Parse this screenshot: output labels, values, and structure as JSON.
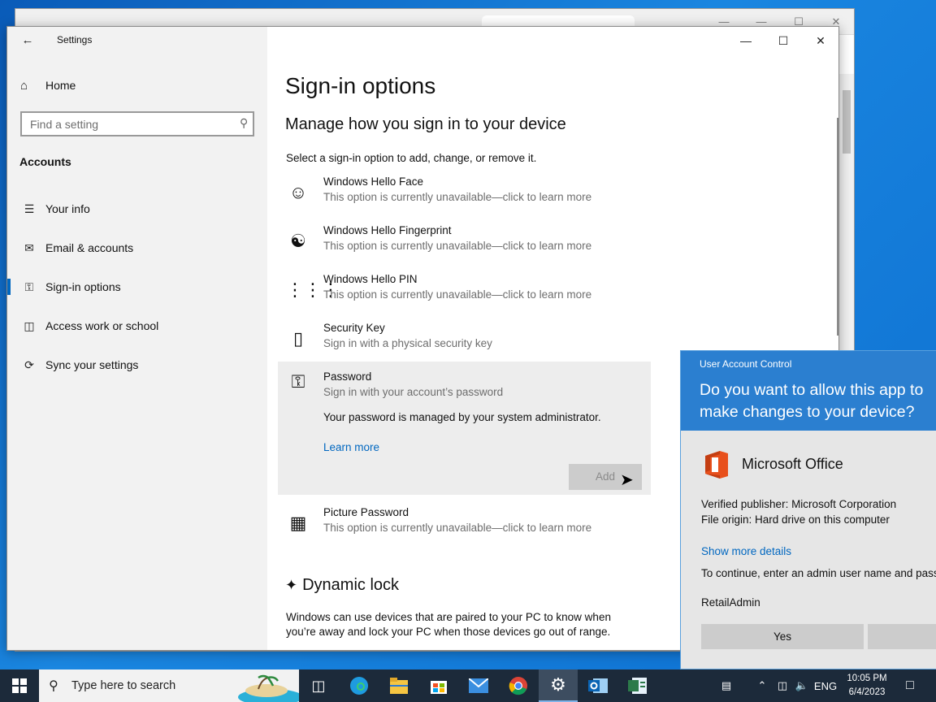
{
  "settings": {
    "app_title": "Settings",
    "home_label": "Home",
    "search_placeholder": "Find a setting",
    "section": "Accounts",
    "nav": [
      {
        "label": "Your info",
        "icon": "person-list-icon"
      },
      {
        "label": "Email & accounts",
        "icon": "mail-icon"
      },
      {
        "label": "Sign-in options",
        "icon": "key-icon",
        "active": true
      },
      {
        "label": "Access work or school",
        "icon": "briefcase-icon"
      },
      {
        "label": "Sync your settings",
        "icon": "sync-icon"
      }
    ],
    "page_title": "Sign-in options",
    "subtitle": "Manage how you sign in to your device",
    "intro": "Select a sign-in option to add, change, or remove it.",
    "options": [
      {
        "title": "Windows Hello Face",
        "desc": "This option is currently unavailable—click to learn more",
        "icon": "face-icon"
      },
      {
        "title": "Windows Hello Fingerprint",
        "desc": "This option is currently unavailable—click to learn more",
        "icon": "fingerprint-icon"
      },
      {
        "title": "Windows Hello PIN",
        "desc": "This option is currently unavailable—click to learn more",
        "icon": "pin-keypad-icon"
      },
      {
        "title": "Security Key",
        "desc": "Sign in with a physical security key",
        "icon": "usb-key-icon"
      },
      {
        "title": "Password",
        "desc": "Sign in with your account’s password",
        "icon": "password-key-icon",
        "note": "Your password is managed by your system administrator.",
        "learn_more": "Learn more",
        "add_label": "Add"
      },
      {
        "title": "Picture Password",
        "desc": "This option is currently unavailable—click to learn more",
        "icon": "picture-icon"
      }
    ],
    "dynamic_lock_title": "Dynamic lock",
    "dynamic_lock_text": "Windows can use devices that are paired to your PC to know when you’re away and lock your PC when those devices go out of range."
  },
  "uac": {
    "header": "User Account Control",
    "question": "Do you want to allow this app to make changes to your device?",
    "app_name": "Microsoft Office",
    "publisher": "Verified publisher: Microsoft Corporation",
    "origin": "File origin: Hard drive on this computer",
    "show_more": "Show more details",
    "continue_text": "To continue, enter an admin user name and password.",
    "user": "RetailAdmin",
    "yes_label": "Yes",
    "accent_color": "#2b7fd0"
  },
  "taskbar": {
    "search_placeholder": "Type here to search",
    "language": "ENG",
    "time": "10:05 PM",
    "date": "6/4/2023"
  }
}
